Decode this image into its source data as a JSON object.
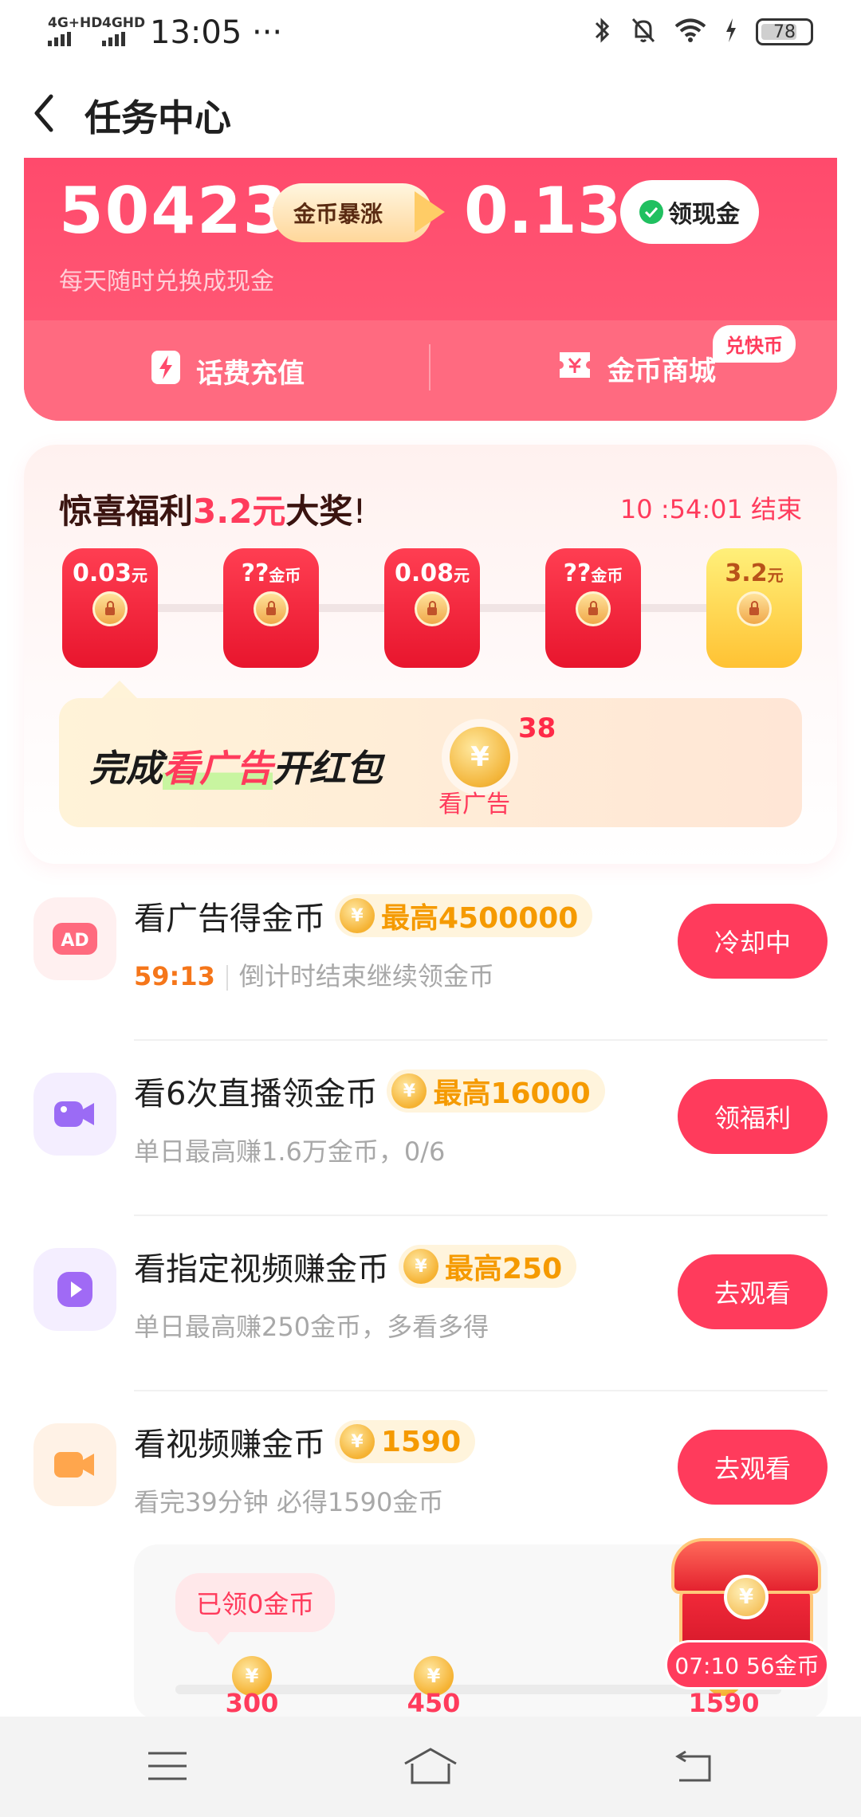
{
  "status_bar": {
    "sim1": "4G+HD",
    "sim2": "4GHD",
    "time": "13:05",
    "more": "···",
    "battery": "78"
  },
  "header": {
    "title": "任务中心"
  },
  "coin_card": {
    "coins": "50423",
    "boost_label": "金币暴涨",
    "cash": "0.13",
    "withdraw_label": "领现金",
    "subtitle": "每天随时兑换成现金",
    "recharge_label": "话费充值",
    "mall_label": "金币商城",
    "mall_tag": "兑快币"
  },
  "surprise": {
    "title_prefix": "惊喜福利",
    "title_amount": "3.2元",
    "title_suffix": "大奖",
    "title_bang": "!",
    "countdown": "10 :54:01 结束",
    "envelopes": [
      {
        "value": "0.03",
        "unit": "元"
      },
      {
        "value": "??",
        "unit": "金币"
      },
      {
        "value": "0.08",
        "unit": "元"
      },
      {
        "value": "??",
        "unit": "金币"
      },
      {
        "value": "3.2",
        "unit": "元"
      }
    ],
    "ad_text_1": "完成",
    "ad_text_2": "看广告",
    "ad_text_3": "开红包",
    "ad_count": "38",
    "ad_label": "看广告"
  },
  "tasks": [
    {
      "name": "看广告得金币",
      "reward": "最高4500000",
      "countdown": "59:13",
      "desc": "倒计时结束继续领金币",
      "button": "冷却中",
      "icon": "ad-icon"
    },
    {
      "name": "看6次直播领金币",
      "reward": "最高16000",
      "desc": "单日最高赚1.6万金币，0/6",
      "button": "领福利",
      "icon": "live-camera-icon"
    },
    {
      "name": "看指定视频赚金币",
      "reward": "最高250",
      "desc": "单日最高赚250金币，多看多得",
      "button": "去观看",
      "icon": "play-icon"
    },
    {
      "name": "看视频赚金币",
      "reward": "1590",
      "desc": "看完39分钟 必得1590金币",
      "button": "去观看",
      "icon": "video-camera-icon"
    }
  ],
  "progress": {
    "claimed": "已领0金币",
    "milestones": [
      "300",
      "450",
      "1590"
    ],
    "chest_timer": "07:10 56金币"
  },
  "coin_glyph": "¥",
  "colors": {
    "accent": "#ff3b5c",
    "gold": "#f59a00",
    "card": "#ff4a6c"
  }
}
